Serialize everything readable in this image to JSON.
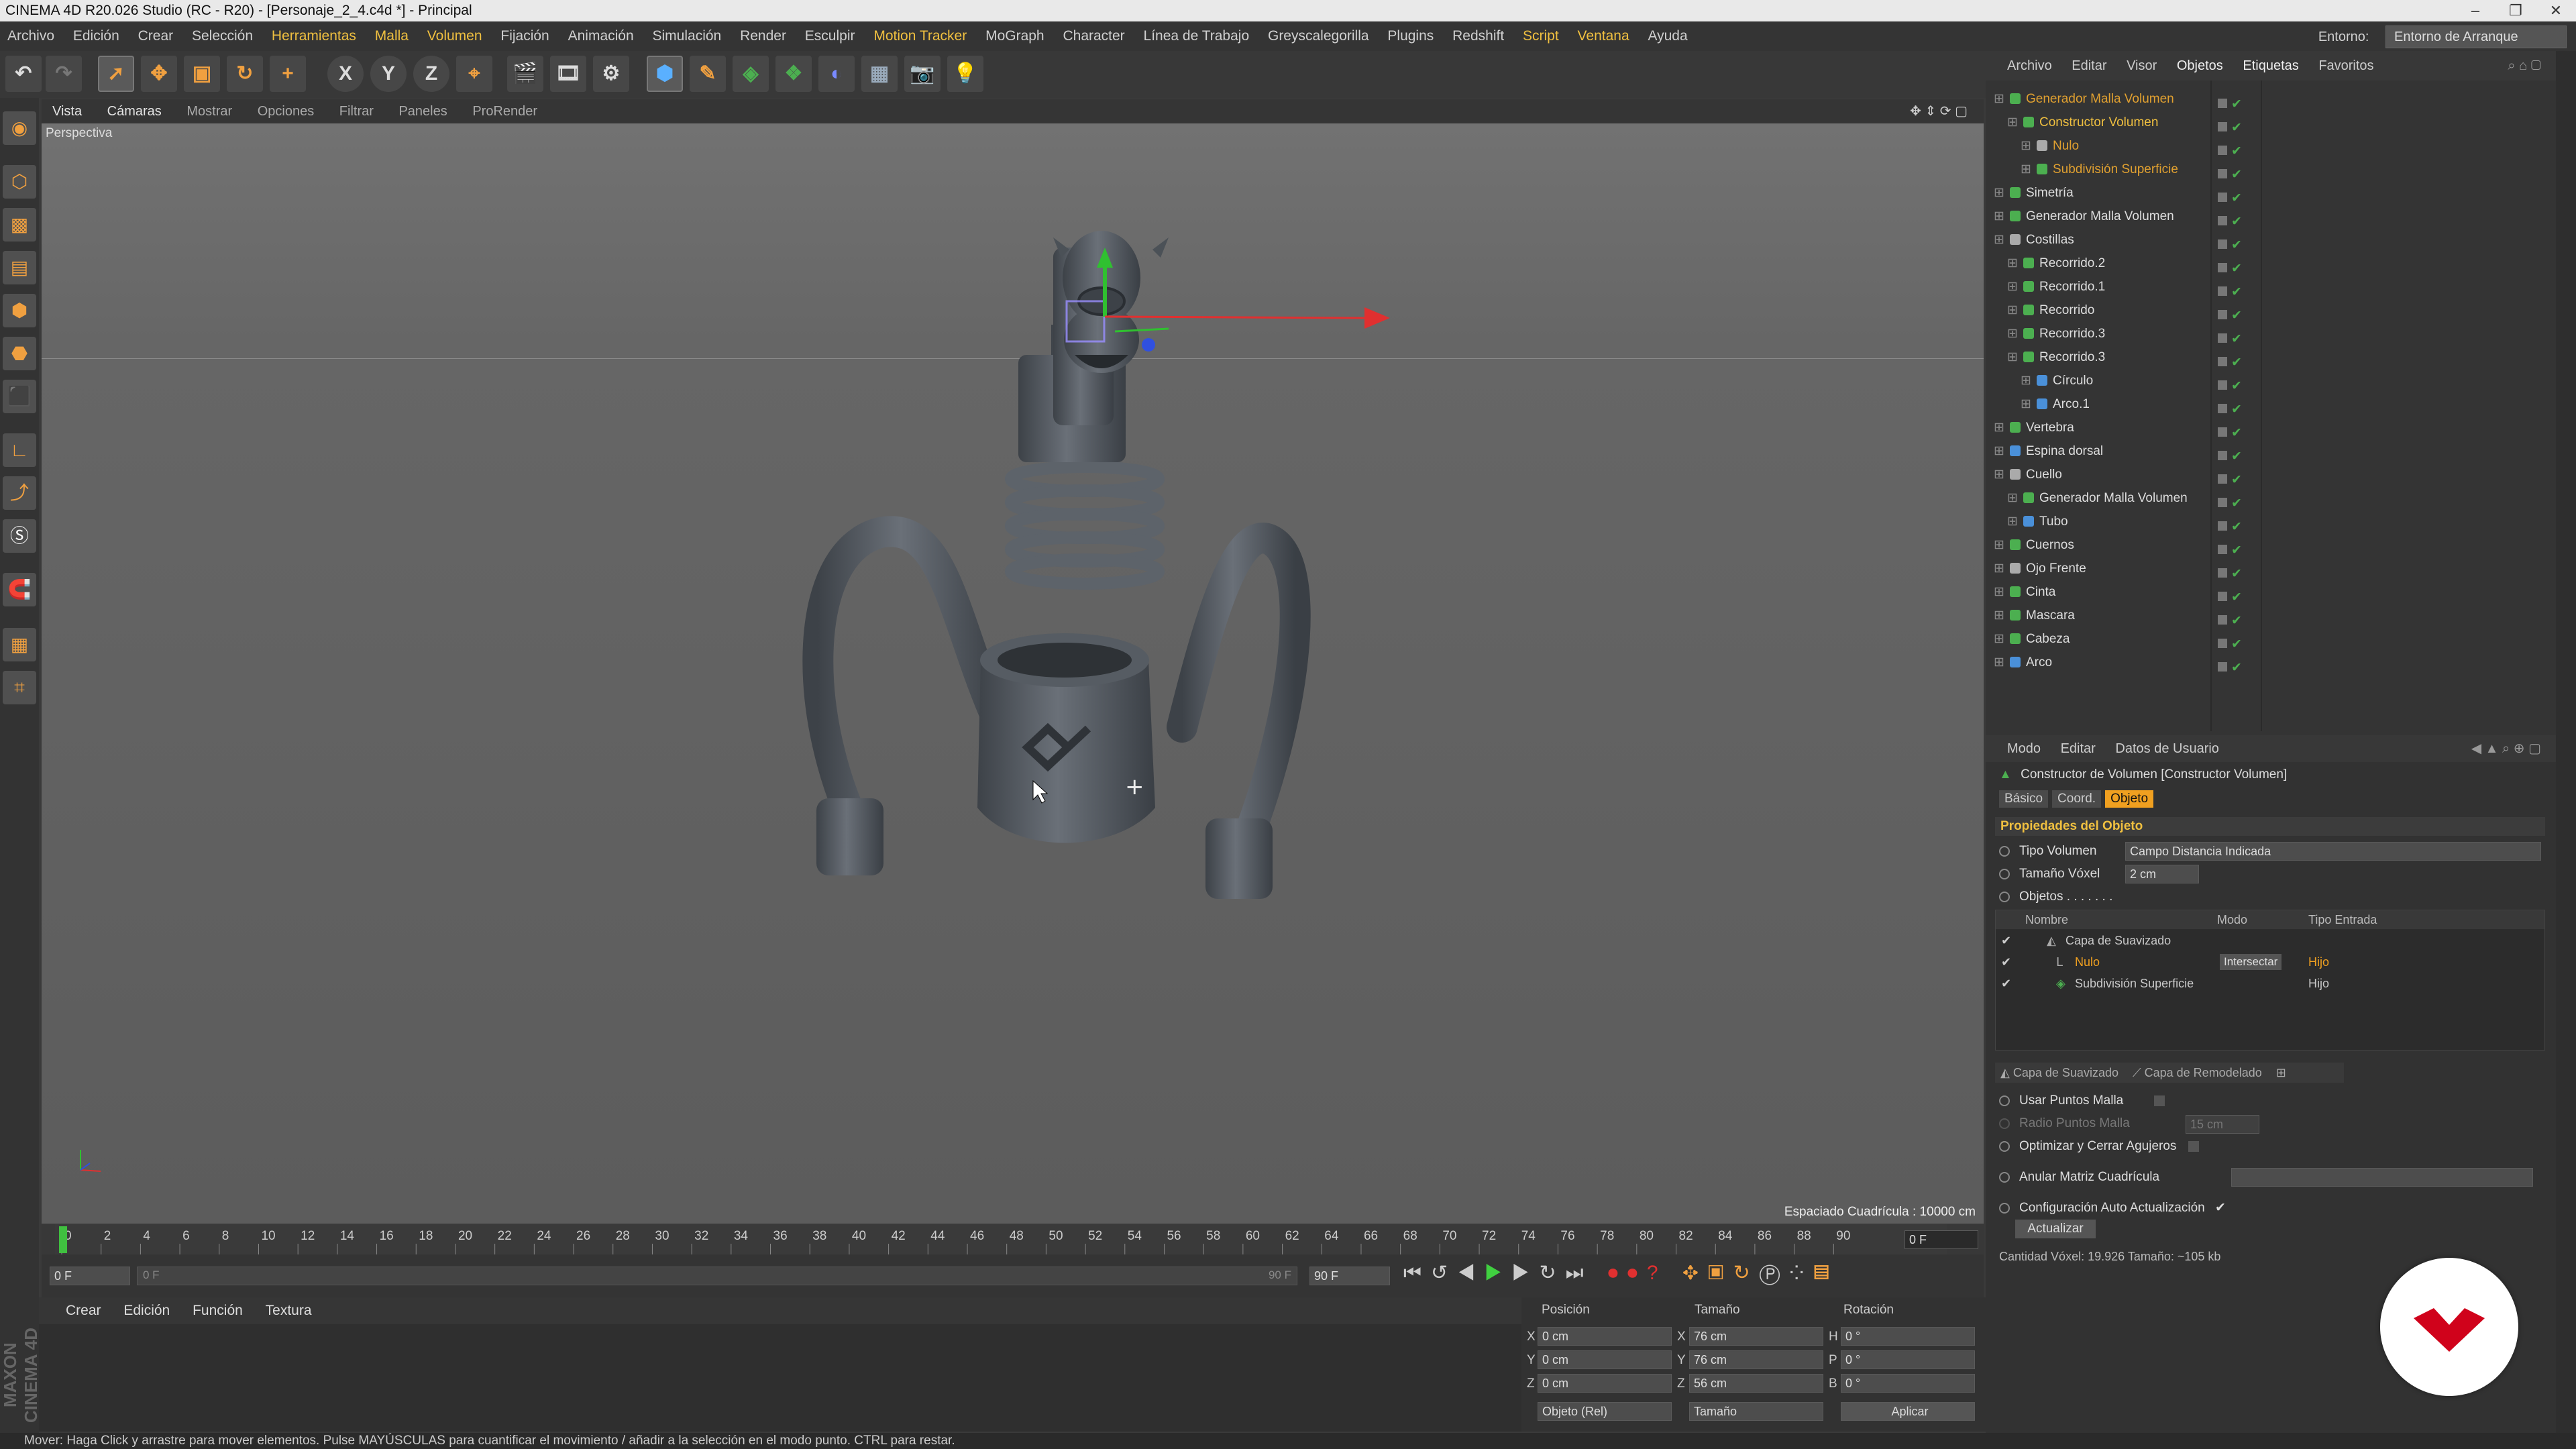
{
  "window": {
    "title": "CINEMA 4D R20.026 Studio (RC - R20) - [Personaje_2_4.c4d *] - Principal",
    "minimize": "–",
    "restore": "❐",
    "close": "✕"
  },
  "menubar": {
    "items": [
      "Archivo",
      "Edición",
      "Crear",
      "Selección",
      "Herramientas",
      "Malla",
      "Volumen",
      "Fijación",
      "Animación",
      "Simulación",
      "Render",
      "Esculpir",
      "Motion Tracker",
      "MoGraph",
      "Character",
      "Línea de Trabajo",
      "Greyscalegorilla",
      "Plugins",
      "Redshift",
      "Script",
      "Ventana",
      "Ayuda"
    ],
    "environment_label": "Entorno:",
    "environment_value": "Entorno de Arranque"
  },
  "toolbar": {
    "axis_x": "X",
    "axis_y": "Y",
    "axis_z": "Z"
  },
  "viewport": {
    "menu": [
      "Vista",
      "Cámaras",
      "Mostrar",
      "Opciones",
      "Filtrar",
      "Paneles",
      "ProRender"
    ],
    "view_name": "Perspectiva",
    "grid_spacing": "Espaciado Cuadrícula : 10000 cm"
  },
  "timeline": {
    "ticks": [
      "0",
      "2",
      "4",
      "6",
      "8",
      "10",
      "12",
      "14",
      "16",
      "18",
      "20",
      "22",
      "24",
      "26",
      "28",
      "30",
      "32",
      "34",
      "36",
      "38",
      "40",
      "42",
      "44",
      "46",
      "48",
      "50",
      "52",
      "54",
      "56",
      "58",
      "60",
      "62",
      "64",
      "66",
      "68",
      "70",
      "72",
      "74",
      "76",
      "78",
      "80",
      "82",
      "84",
      "86",
      "88",
      "90"
    ],
    "current_frame": "0 F",
    "start_field": "0 F",
    "range_start": "0 F",
    "range_end": "90 F",
    "end_field": "90 F"
  },
  "material_panel": {
    "menu": [
      "Crear",
      "Edición",
      "Función",
      "Textura"
    ]
  },
  "coords": {
    "headers": [
      "Posición",
      "Tamaño",
      "Rotación"
    ],
    "rows": [
      {
        "axis": "X",
        "pos": "0 cm",
        "size_axis": "X",
        "size": "76 cm",
        "rot_axis": "H",
        "rot": "0 °"
      },
      {
        "axis": "Y",
        "pos": "0 cm",
        "size_axis": "Y",
        "size": "76 cm",
        "rot_axis": "P",
        "rot": "0 °"
      },
      {
        "axis": "Z",
        "pos": "0 cm",
        "size_axis": "Z",
        "size": "56 cm",
        "rot_axis": "B",
        "rot": "0 °"
      }
    ],
    "mode": "Objeto (Rel)",
    "size_mode": "Tamaño",
    "apply": "Aplicar"
  },
  "statusbar": {
    "text": "Mover: Haga Click y arrastre para mover elementos. Pulse MAYÚSCULAS para cuantificar el movimiento / añadir a la selección en el modo punto. CTRL para restar."
  },
  "object_manager": {
    "menu": [
      "Archivo",
      "Editar",
      "Visor",
      "Objetos",
      "Etiquetas",
      "Favoritos"
    ],
    "objects": [
      {
        "name": "Generador Malla Volumen",
        "indent": 0,
        "color": "#e0a030",
        "icon": "#4caf50"
      },
      {
        "name": "Constructor Volumen",
        "indent": 1,
        "color": "#f0c040",
        "icon": "#4caf50"
      },
      {
        "name": "Nulo",
        "indent": 2,
        "color": "#e0a030",
        "icon": "#aaaaaa"
      },
      {
        "name": "Subdivisión Superficie",
        "indent": 2,
        "color": "#e0a030",
        "icon": "#4caf50"
      },
      {
        "name": "Simetría",
        "indent": 0,
        "color": "#dddddd",
        "icon": "#4caf50"
      },
      {
        "name": "Generador Malla Volumen",
        "indent": 0,
        "color": "#dddddd",
        "icon": "#4caf50"
      },
      {
        "name": "Costillas",
        "indent": 0,
        "color": "#dddddd",
        "icon": "#aaaaaa"
      },
      {
        "name": "Recorrido.2",
        "indent": 1,
        "color": "#dddddd",
        "icon": "#4caf50"
      },
      {
        "name": "Recorrido.1",
        "indent": 1,
        "color": "#dddddd",
        "icon": "#4caf50"
      },
      {
        "name": "Recorrido",
        "indent": 1,
        "color": "#dddddd",
        "icon": "#4caf50"
      },
      {
        "name": "Recorrido.3",
        "indent": 1,
        "color": "#dddddd",
        "icon": "#4caf50"
      },
      {
        "name": "Recorrido.3",
        "indent": 1,
        "color": "#dddddd",
        "icon": "#4caf50"
      },
      {
        "name": "Círculo",
        "indent": 2,
        "color": "#dddddd",
        "icon": "#4a90d9"
      },
      {
        "name": "Arco.1",
        "indent": 2,
        "color": "#dddddd",
        "icon": "#4a90d9"
      },
      {
        "name": "Vertebra",
        "indent": 0,
        "color": "#dddddd",
        "icon": "#4caf50"
      },
      {
        "name": "Espina dorsal",
        "indent": 0,
        "color": "#dddddd",
        "icon": "#4a90d9"
      },
      {
        "name": "Cuello",
        "indent": 0,
        "color": "#dddddd",
        "icon": "#aaaaaa"
      },
      {
        "name": "Generador Malla Volumen",
        "indent": 1,
        "color": "#dddddd",
        "icon": "#4caf50"
      },
      {
        "name": "Tubo",
        "indent": 1,
        "color": "#dddddd",
        "icon": "#4a90d9"
      },
      {
        "name": "Cuernos",
        "indent": 0,
        "color": "#dddddd",
        "icon": "#4caf50"
      },
      {
        "name": "Ojo Frente",
        "indent": 0,
        "color": "#dddddd",
        "icon": "#aaaaaa"
      },
      {
        "name": "Cinta",
        "indent": 0,
        "color": "#dddddd",
        "icon": "#4caf50"
      },
      {
        "name": "Mascara",
        "indent": 0,
        "color": "#dddddd",
        "icon": "#4caf50"
      },
      {
        "name": "Cabeza",
        "indent": 0,
        "color": "#dddddd",
        "icon": "#4caf50"
      },
      {
        "name": "Arco",
        "indent": 0,
        "color": "#dddddd",
        "icon": "#4a90d9"
      }
    ]
  },
  "attributes": {
    "menu": [
      "Modo",
      "Editar",
      "Datos de Usuario"
    ],
    "header": "Constructor de Volumen [Constructor Volumen]",
    "tabs": [
      "Básico",
      "Coord.",
      "Objeto"
    ],
    "active_tab": "Objeto",
    "section": "Propiedades del Objeto",
    "tipo_label": "Tipo Volumen",
    "tipo_value": "Campo Distancia Indicada",
    "voxel_label": "Tamaño Vóxel",
    "voxel_value": "2 cm",
    "objetos_label": "Objetos . . . . . . .",
    "list_headers": [
      "Nombre",
      "Modo",
      "Tipo Entrada"
    ],
    "list": [
      {
        "name": "Capa de Suavizado",
        "mode": "",
        "type": ""
      },
      {
        "name": "Nulo",
        "mode": "Intersectar",
        "type": "Hijo"
      },
      {
        "name": "Subdivisión Superficie",
        "mode": "",
        "type": "Hijo"
      }
    ],
    "layer_buttons": [
      "Capa de Suavizado",
      "Capa de Remodelado"
    ],
    "usar_puntos": "Usar Puntos Malla",
    "radio_puntos": "Radio Puntos Malla",
    "radio_value": "15 cm",
    "optimizar": "Optimizar y Cerrar Agujeros",
    "anular": "Anular Matriz Cuadrícula",
    "auto_config": "Configuración Auto Actualización",
    "actualizar": "Actualizar",
    "voxel_count": "Cantidad Vóxel: 19.926  Tamaño: ~105 kb"
  },
  "branding": {
    "logo_text": "MAXON CINEMA 4D"
  },
  "colors": {
    "accent": "#f0a020",
    "selected_text": "#f0c040",
    "x_axis": "#e03030",
    "y_axis": "#30c030",
    "z_axis": "#3050e0"
  }
}
